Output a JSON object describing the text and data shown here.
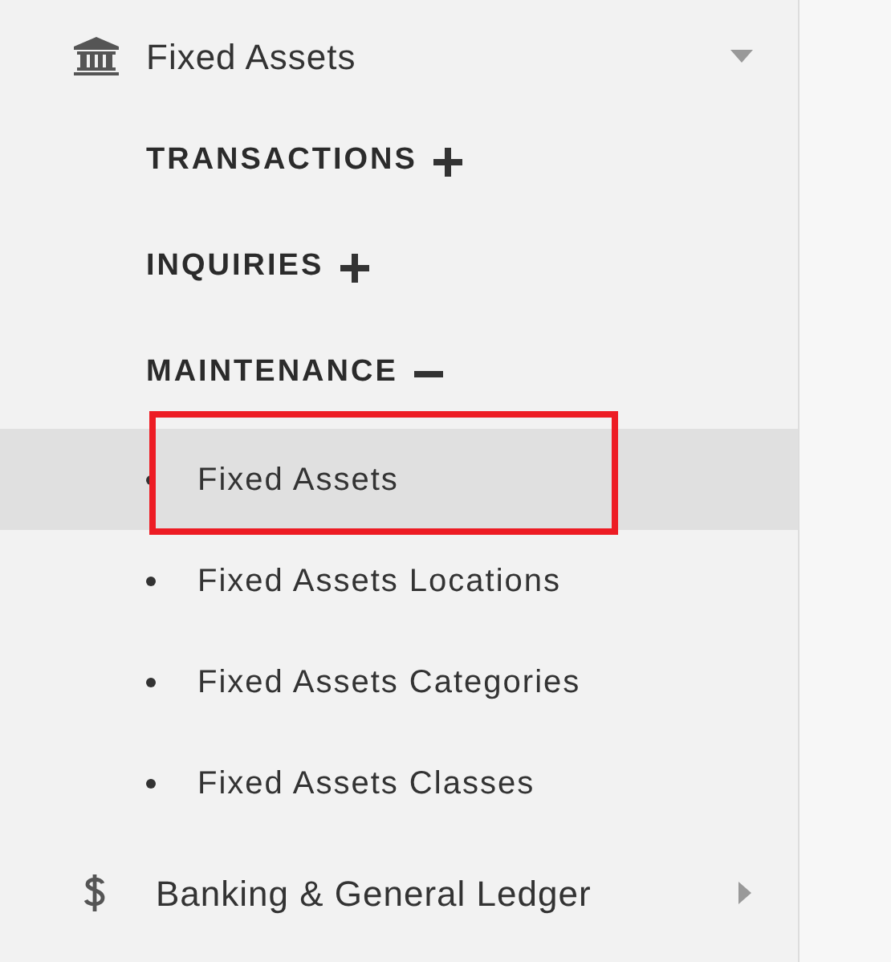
{
  "sidebar": {
    "modules": [
      {
        "label": "Fixed Assets",
        "kind": "bank",
        "expanded": true,
        "sections": [
          {
            "label": "TRANSACTIONS",
            "expanded": false
          },
          {
            "label": "INQUIRIES",
            "expanded": false
          },
          {
            "label": "MAINTENANCE",
            "expanded": true,
            "items": [
              {
                "label": "Fixed Assets",
                "selected": true,
                "annotated": true
              },
              {
                "label": "Fixed Assets Locations",
                "selected": false,
                "annotated": false
              },
              {
                "label": "Fixed Assets Categories",
                "selected": false,
                "annotated": false
              },
              {
                "label": "Fixed Assets Classes",
                "selected": false,
                "annotated": false
              }
            ]
          }
        ]
      },
      {
        "label": "Banking & General Ledger",
        "kind": "dollar",
        "expanded": false
      }
    ]
  }
}
